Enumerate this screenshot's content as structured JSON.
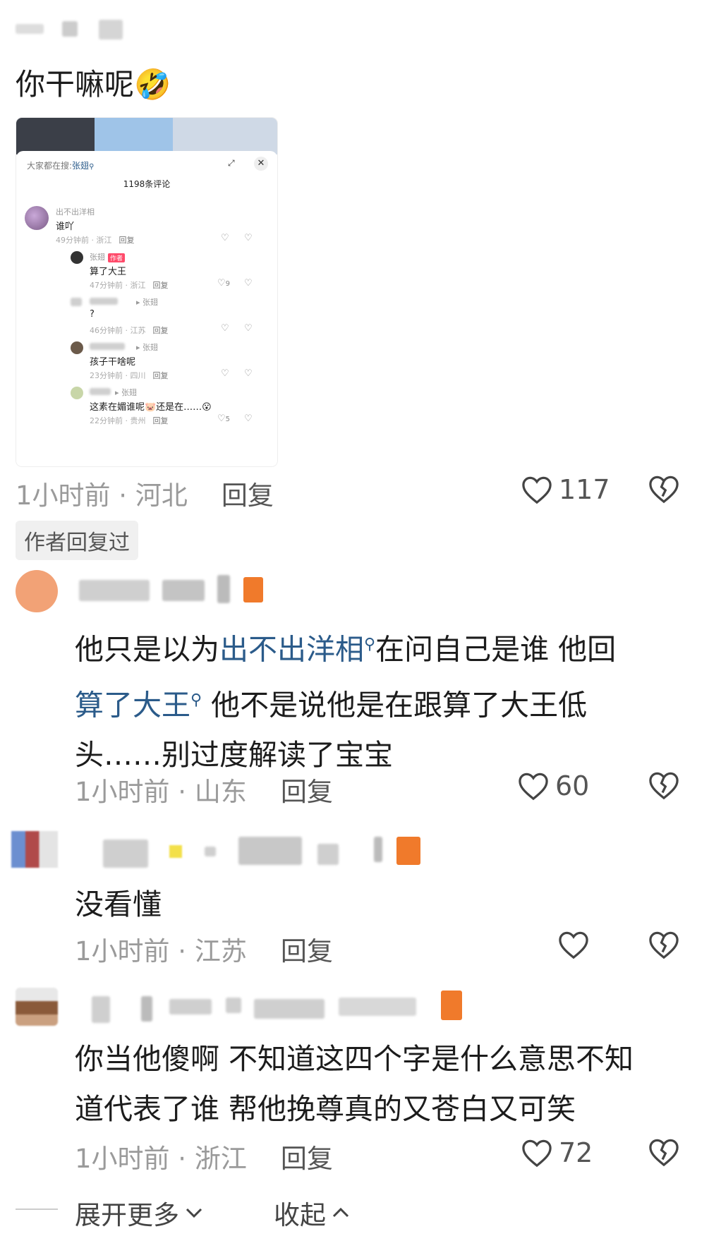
{
  "post": {
    "text": "你干嘛呢",
    "emoji": "🤣",
    "time": "1小时前 · 河北",
    "reply_label": "回复",
    "likes": "117",
    "author_replied": "作者回复过"
  },
  "screenshot": {
    "search_prefix": "大家都在搜:",
    "search_term": "张翅",
    "comment_count": "1198条评论",
    "comments": [
      {
        "name": "出不出洋相",
        "text": "谁吖",
        "meta": "49分钟前 · 浙江",
        "reply": "回复",
        "likes": ""
      },
      {
        "name": "张翅",
        "tag": "作者",
        "text": "算了大王",
        "meta": "47分钟前 · 浙江",
        "reply": "回复",
        "likes": "9"
      },
      {
        "name": "张翅",
        "text": "?",
        "meta": "46分钟前 · 江苏",
        "reply": "回复",
        "likes": ""
      },
      {
        "name": "张翅",
        "text": "孩子干啥呢",
        "meta": "23分钟前 · 四川",
        "reply": "回复",
        "likes": ""
      },
      {
        "name": "张翅",
        "text": "这素在媚谁呢🐷还是在……😮",
        "meta": "22分钟前 · 贵州",
        "reply": "回复",
        "likes": "5"
      }
    ]
  },
  "comments": [
    {
      "part1": "他只是以为",
      "link1": "出不出洋相",
      "part2": "在问自己是谁 他回",
      "link2": "算了大王",
      "part3": " 他不是说他是在跟算了大王低",
      "part4": "头……别过度解读了宝宝",
      "time": "1小时前 · 山东",
      "reply_label": "回复",
      "likes": "60"
    },
    {
      "text": "没看懂",
      "time": "1小时前 · 江苏",
      "reply_label": "回复",
      "likes": ""
    },
    {
      "line1": "你当他傻啊 不知道这四个字是什么意思不知",
      "line2": "道代表了谁 帮他挽尊真的又苍白又可笑",
      "time": "1小时前 · 浙江",
      "reply_label": "回复",
      "likes": "72"
    }
  ],
  "footer": {
    "expand_label": "展开更多",
    "collapse_label": "收起"
  },
  "colors": {
    "link": "#2b5b8a",
    "meta": "#9a9a9a",
    "author_tag": "#ff4a6a"
  }
}
